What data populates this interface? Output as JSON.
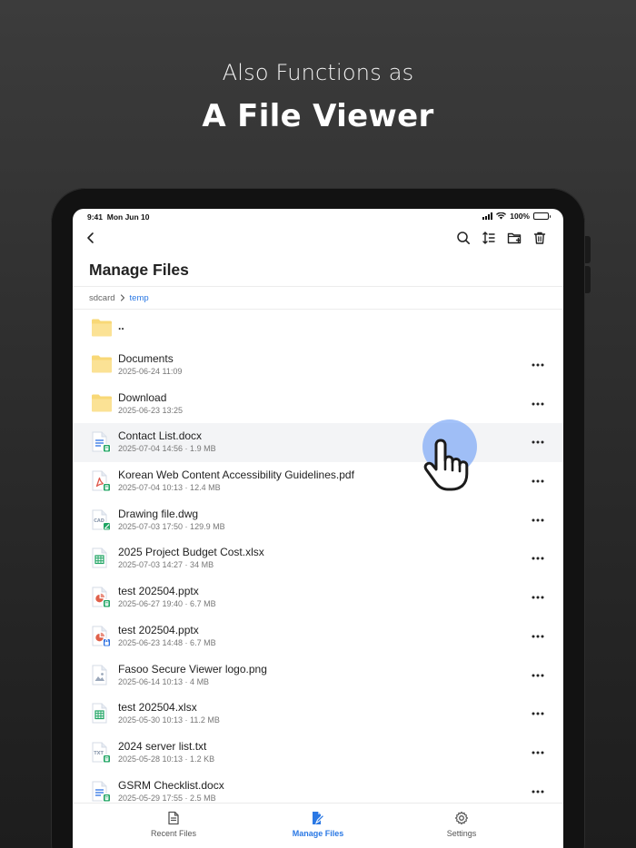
{
  "promo": {
    "subtitle": "Also Functions as",
    "title": "A File Viewer"
  },
  "status_bar": {
    "time": "9:41",
    "date": "Mon Jun 10",
    "battery": "100%"
  },
  "header": {
    "title": "Manage Files"
  },
  "breadcrumb": {
    "root": "sdcard",
    "current": "temp"
  },
  "parent_folder": {
    "name": ".."
  },
  "files": [
    {
      "name": "Documents",
      "meta": "2025-06-24 11:09",
      "icon": "folder-icon"
    },
    {
      "name": "Download",
      "meta": "2025-06-23 13:25",
      "icon": "folder-icon"
    },
    {
      "name": "Contact List.docx",
      "meta": "2025-07-04 14:56 · 1.9 MB",
      "icon": "docx-file-icon"
    },
    {
      "name": "Korean Web Content Accessibility Guidelines.pdf",
      "meta": "2025-07-04 10:13 · 12.4 MB",
      "icon": "pdf-file-icon"
    },
    {
      "name": "Drawing file.dwg",
      "meta": "2025-07-03 17:50 · 129.9 MB",
      "icon": "cad-file-icon"
    },
    {
      "name": "2025 Project Budget Cost.xlsx",
      "meta": "2025-07-03 14:27 · 34 MB",
      "icon": "xlsx-file-icon"
    },
    {
      "name": "test 202504.pptx",
      "meta": "2025-06-27 19:40 · 6.7 MB",
      "icon": "pptx-file-icon"
    },
    {
      "name": "test 202504.pptx",
      "meta": "2025-06-23 14:48 · 6.7 MB",
      "icon": "pptx-locked-file-icon"
    },
    {
      "name": "Fasoo Secure Viewer logo.png",
      "meta": "2025-06-14 10:13 · 4 MB",
      "icon": "image-file-icon"
    },
    {
      "name": "test 202504.xlsx",
      "meta": "2025-05-30 10:13 · 11.2 MB",
      "icon": "xlsx-file-icon"
    },
    {
      "name": "2024 server list.txt",
      "meta": "2025-05-28 10:13 · 1.2 KB",
      "icon": "txt-file-icon"
    },
    {
      "name": "GSRM Checklist.docx",
      "meta": "2025-05-29 17:55 · 2.5 MB",
      "icon": "docx-file-icon"
    }
  ],
  "icon_labels": {
    "cad": "CAD",
    "txt": "TXT"
  },
  "tabs": [
    {
      "label": "Recent Files",
      "active": false
    },
    {
      "label": "Manage Files",
      "active": true
    },
    {
      "label": "Settings",
      "active": false
    }
  ],
  "colors": {
    "accent": "#2a78e4",
    "folder": "#f8d877",
    "doc_blue": "#4a86e8",
    "sheet_green": "#1fa463",
    "pdf_red": "#e05b4f",
    "ppt_red": "#e0604a",
    "badge_green": "#1fa463",
    "badge_blue": "#2a6fe0"
  }
}
